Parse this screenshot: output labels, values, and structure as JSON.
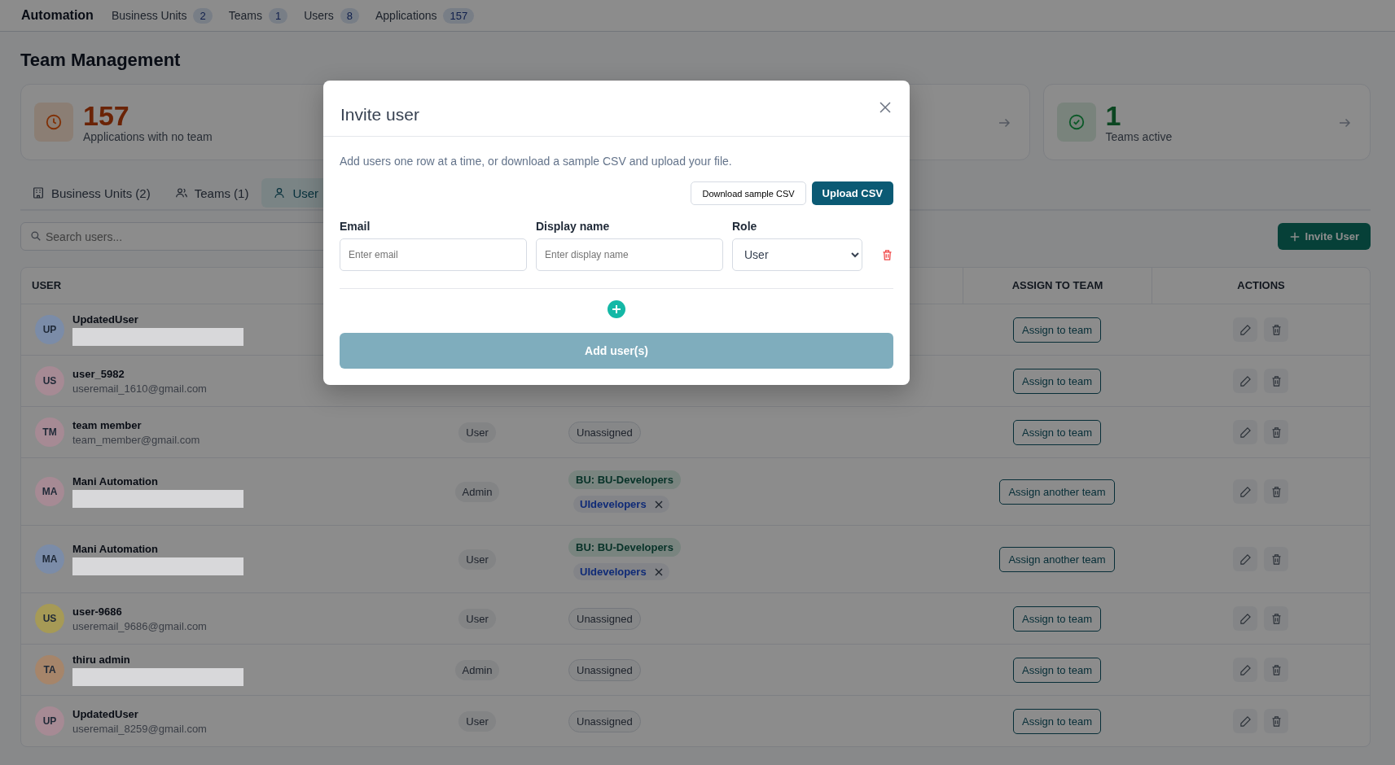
{
  "nav": {
    "brand": "Automation",
    "items": [
      {
        "label": "Business Units",
        "count": "2"
      },
      {
        "label": "Teams",
        "count": "1"
      },
      {
        "label": "Users",
        "count": "8"
      },
      {
        "label": "Applications",
        "count": "157"
      }
    ]
  },
  "page_title": "Team Management",
  "stat_cards": [
    {
      "kind": "warning",
      "value": "157",
      "label": "Applications with no team"
    },
    {
      "kind": "blank"
    },
    {
      "kind": "covered"
    },
    {
      "kind": "success",
      "value": "1",
      "label": "Teams active"
    }
  ],
  "tabs": [
    {
      "kind": "building",
      "label": "Business Units (2)",
      "selected": false
    },
    {
      "kind": "users",
      "label": "Teams (1)",
      "selected": false
    },
    {
      "kind": "user",
      "label": "User",
      "selected": true
    }
  ],
  "search": {
    "placeholder": "Search users..."
  },
  "invite_button": "Invite User",
  "table": {
    "headers": {
      "user": "USER",
      "assign": "ASSIGN TO TEAM",
      "actions": "ACTIONS"
    },
    "rows": [
      {
        "initials": "UP",
        "color": "#7b8ca8",
        "name": "UpdatedUser",
        "email_redacted": true,
        "assign_label": "Assign to team"
      },
      {
        "initials": "US",
        "color": "#a68a94",
        "name": "user_5982",
        "email": "useremail_1610@gmail.com",
        "assign_label": "Assign to team"
      },
      {
        "initials": "TM",
        "color": "#a68a94",
        "name": "team member",
        "email": "team_member@gmail.com",
        "role": "User",
        "team": {
          "kind": "unassigned",
          "label": "Unassigned"
        },
        "assign_label": "Assign to team"
      },
      {
        "initials": "MA",
        "color": "#a68a94",
        "name": "Mani Automation",
        "email_redacted": true,
        "role": "Admin",
        "team": {
          "kind": "assigned",
          "bu": "BU: BU-Developers",
          "team": "UIdevelopers"
        },
        "assign_label": "Assign another team"
      },
      {
        "initials": "MA",
        "color": "#7b8ca8",
        "name": "Mani Automation",
        "email_redacted": true,
        "role": "User",
        "team": {
          "kind": "assigned",
          "bu": "BU: BU-Developers",
          "team": "UIdevelopers"
        },
        "assign_label": "Assign another team"
      },
      {
        "initials": "US",
        "color": "#a69a56",
        "name": "user-9686",
        "email": "useremail_9686@gmail.com",
        "role": "User",
        "team": {
          "kind": "unassigned",
          "label": "Unassigned"
        },
        "assign_label": "Assign to team"
      },
      {
        "initials": "TA",
        "color": "#a6856a",
        "name": "thiru admin",
        "email_redacted": true,
        "role": "Admin",
        "team": {
          "kind": "unassigned",
          "label": "Unassigned"
        },
        "assign_label": "Assign to team"
      },
      {
        "initials": "UP",
        "color": "#a68a94",
        "name": "UpdatedUser",
        "email": "useremail_8259@gmail.com",
        "role": "User",
        "team": {
          "kind": "unassigned",
          "label": "Unassigned"
        },
        "assign_label": "Assign to team"
      }
    ]
  },
  "modal": {
    "title": "Invite user",
    "description": "Add users one row at a time, or download a sample CSV and upload your file.",
    "download_button": "Download sample CSV",
    "upload_button": "Upload CSV",
    "fields": {
      "email_label": "Email",
      "email_placeholder": "Enter email",
      "name_label": "Display name",
      "name_placeholder": "Enter display name",
      "role_label": "Role",
      "role_value": "User"
    },
    "submit": {
      "label": "Add user(s)",
      "disabled": true
    }
  }
}
